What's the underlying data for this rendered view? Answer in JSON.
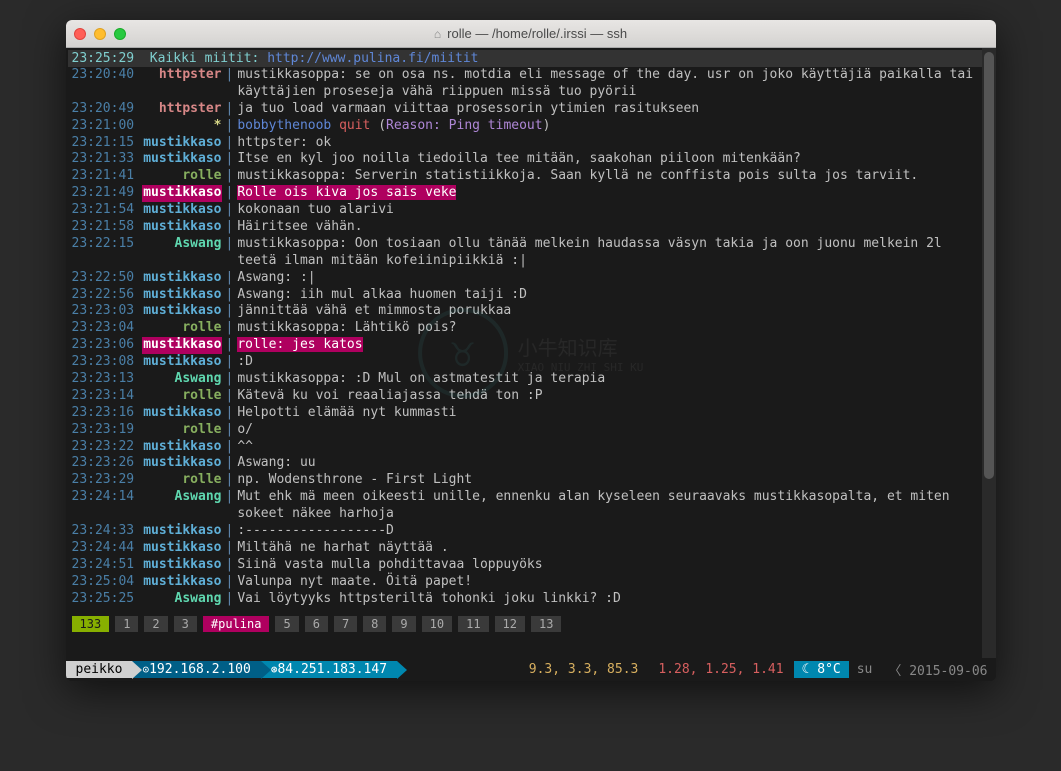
{
  "titlebar": {
    "title": "rolle — /home/rolle/.irssi — ssh"
  },
  "topbar": {
    "time": "23:25:29",
    "text": "Kaikki miitit: ",
    "url": "http://www.pulina.fi/miitit"
  },
  "lines": [
    {
      "time": "23:20:40",
      "nick": "httpster",
      "nickClass": "nick-httpster",
      "msg": "mustikkasoppa: se on osa ns. motdia eli message of the day. usr on joko käyttäjiä paikalla tai käyttäjien proseseja vähä riippuen missä tuo pyörii"
    },
    {
      "time": "23:20:49",
      "nick": "httpster",
      "nickClass": "nick-httpster",
      "msg": "ja tuo load varmaan viittaa prosessorin ytimien rasitukseen"
    },
    {
      "time": "23:21:00",
      "nick": "*",
      "nickClass": "nick-star",
      "type": "event",
      "bobby": "bobbythenoob",
      "quit": "quit",
      "reason": "Reason: Ping timeout"
    },
    {
      "time": "23:21:15",
      "nick": "mustikkaso",
      "nickClass": "nick-mustikkaso",
      "msg": "httpster: ok"
    },
    {
      "time": "23:21:33",
      "nick": "mustikkaso",
      "nickClass": "nick-mustikkaso",
      "msg": "Itse en kyl joo noilla tiedoilla tee mitään, saakohan piiloon mitenkään?"
    },
    {
      "time": "23:21:41",
      "nick": "rolle",
      "nickClass": "nick-rolle",
      "msg": "mustikkasoppa: Serverin statistiikkoja. Saan kyllä ne conffista pois sulta jos tarviit."
    },
    {
      "time": "23:21:49",
      "nick": "mustikkaso",
      "nickClass": "nick-mustikkaso",
      "hl": true,
      "msg": "Rolle ois kiva jos sais veke"
    },
    {
      "time": "23:21:54",
      "nick": "mustikkaso",
      "nickClass": "nick-mustikkaso",
      "msg": "kokonaan tuo alarivi"
    },
    {
      "time": "23:21:58",
      "nick": "mustikkaso",
      "nickClass": "nick-mustikkaso",
      "msg": "Häiritsee vähän."
    },
    {
      "time": "23:22:15",
      "nick": "Aswang",
      "nickClass": "nick-aswang",
      "msg": "mustikkasoppa: Oon tosiaan ollu tänää melkein haudassa väsyn takia ja oon juonu melkein 2l teetä ilman mitään kofeiinipiikkiä :|"
    },
    {
      "time": "23:22:50",
      "nick": "mustikkaso",
      "nickClass": "nick-mustikkaso",
      "msg": "Aswang: :|"
    },
    {
      "time": "23:22:56",
      "nick": "mustikkaso",
      "nickClass": "nick-mustikkaso",
      "msg": "Aswang: iih mul alkaa huomen taiji :D"
    },
    {
      "time": "23:23:03",
      "nick": "mustikkaso",
      "nickClass": "nick-mustikkaso",
      "msg": "jännittää vähä et mimmosta porukkaa"
    },
    {
      "time": "23:23:04",
      "nick": "rolle",
      "nickClass": "nick-rolle",
      "msg": "mustikkasoppa: Lähtikö pois?"
    },
    {
      "time": "23:23:06",
      "nick": "mustikkaso",
      "nickClass": "nick-mustikkaso",
      "hl": true,
      "msg": "rolle: jes katos"
    },
    {
      "time": "23:23:08",
      "nick": "mustikkaso",
      "nickClass": "nick-mustikkaso",
      "msg": ":D"
    },
    {
      "time": "23:23:13",
      "nick": "Aswang",
      "nickClass": "nick-aswang",
      "msg": "mustikkasoppa: :D Mul on astmatestit ja terapia"
    },
    {
      "time": "23:23:14",
      "nick": "rolle",
      "nickClass": "nick-rolle",
      "msg": "Kätevä ku voi reaaliajassa tehdä ton :P"
    },
    {
      "time": "23:23:16",
      "nick": "mustikkaso",
      "nickClass": "nick-mustikkaso",
      "msg": "Helpotti elämää nyt kummasti"
    },
    {
      "time": "23:23:19",
      "nick": "rolle",
      "nickClass": "nick-rolle",
      "msg": "o/"
    },
    {
      "time": "23:23:22",
      "nick": "mustikkaso",
      "nickClass": "nick-mustikkaso",
      "msg": "^^"
    },
    {
      "time": "23:23:26",
      "nick": "mustikkaso",
      "nickClass": "nick-mustikkaso",
      "msg": "Aswang: uu"
    },
    {
      "time": "23:23:29",
      "nick": "rolle",
      "nickClass": "nick-rolle",
      "msg": "np. Wodensthrone - First Light"
    },
    {
      "time": "23:24:14",
      "nick": "Aswang",
      "nickClass": "nick-aswang",
      "msg": "Mut ehk mä meen oikeesti unille, ennenku alan kyseleen seuraavaks mustikkasopalta, et miten sokeet näkee harhoja"
    },
    {
      "time": "23:24:33",
      "nick": "mustikkaso",
      "nickClass": "nick-mustikkaso",
      "msg": ":------------------D"
    },
    {
      "time": "23:24:44",
      "nick": "mustikkaso",
      "nickClass": "nick-mustikkaso",
      "msg": "Miltähä ne harhat näyttää ."
    },
    {
      "time": "23:24:51",
      "nick": "mustikkaso",
      "nickClass": "nick-mustikkaso",
      "msg": "Siinä vasta mulla pohdittavaa loppuyöks"
    },
    {
      "time": "23:25:04",
      "nick": "mustikkaso",
      "nickClass": "nick-mustikkaso",
      "msg": "Valunpa nyt maate. Öitä papet!"
    },
    {
      "time": "23:25:25",
      "nick": "Aswang",
      "nickClass": "nick-aswang",
      "msg": "Vai löytyyks httpsteriltä tohonki joku linkki? :D"
    }
  ],
  "tabs": [
    {
      "label": "133",
      "cls": "active"
    },
    {
      "label": "1"
    },
    {
      "label": "2"
    },
    {
      "label": "3"
    },
    {
      "label": "#pulina",
      "cls": "channel"
    },
    {
      "label": "5"
    },
    {
      "label": "6"
    },
    {
      "label": "7"
    },
    {
      "label": "8"
    },
    {
      "label": "9"
    },
    {
      "label": "10"
    },
    {
      "label": "11"
    },
    {
      "label": "12"
    },
    {
      "label": "13"
    }
  ],
  "status": {
    "host": "peikko",
    "ip1": "192.168.2.100",
    "ip2": "84.251.183.147",
    "cpu": "9.3,  3.3, 85.3",
    "load": "1.28, 1.25, 1.41",
    "temp": "☾ 8°C",
    "day": "su",
    "date": "2015-09-06"
  },
  "watermark": {
    "chars": "小牛知识库",
    "sub": "XIAO NIU ZHI SHI KU"
  }
}
